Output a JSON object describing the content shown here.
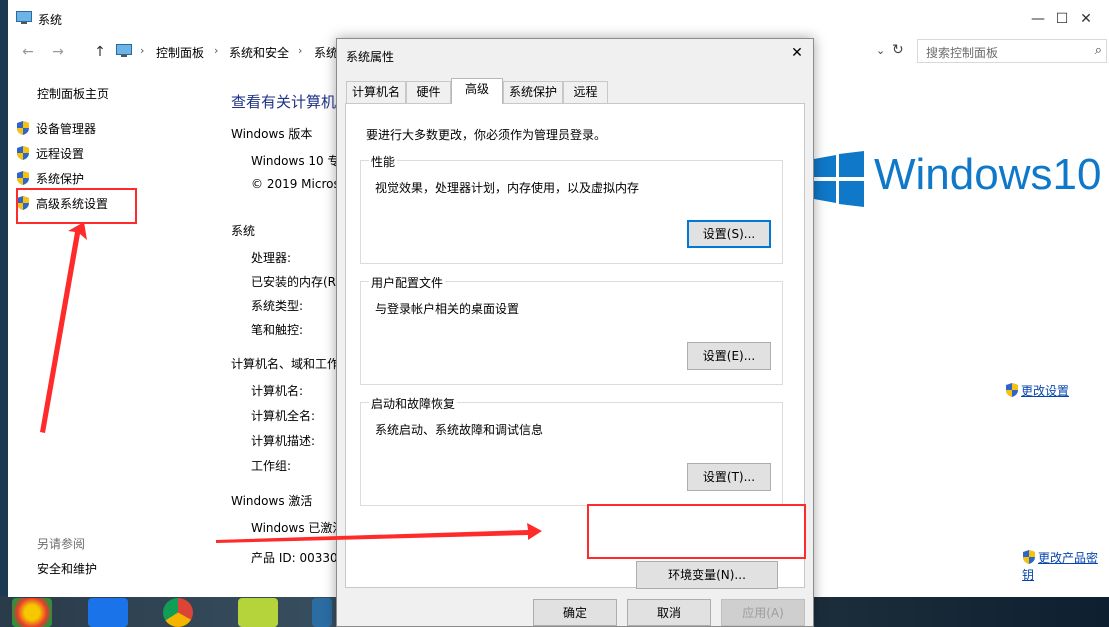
{
  "window": {
    "title": "系统",
    "minimize": "—",
    "maximize": "☐",
    "close": "✕"
  },
  "address": {
    "back": "←",
    "forward": "→",
    "up": "↑",
    "crumbs": [
      "控制面板",
      "系统和安全",
      "系统"
    ],
    "search_placeholder": "搜索控制面板"
  },
  "left_pane": {
    "home": "控制面板主页",
    "items": [
      "设备管理器",
      "远程设置",
      "系统保护",
      "高级系统设置"
    ],
    "see_also": "另请参阅",
    "security": "安全和维护"
  },
  "main": {
    "title": "查看有关计算机",
    "windows_edition_head": "Windows 版本",
    "edition": "Windows 10 专",
    "copyright": "© 2019 Micros",
    "system_head": "系统",
    "processor": "处理器:",
    "ram": "已安装的内存(R",
    "system_type": "系统类型:",
    "pen_touch": "笔和触控:",
    "computer_name_head": "计算机名、域和工作",
    "computer_name": "计算机名:",
    "full_name": "计算机全名:",
    "description": "计算机描述:",
    "workgroup": "工作组:",
    "activation_head": "Windows 激活",
    "activation": "Windows 已激活",
    "product_id": "产品 ID: 00330",
    "logo_text": "Windows10",
    "change_settings": "更改设置",
    "change_key": "更改产品密钥"
  },
  "dialog": {
    "title": "系统属性",
    "close": "✕",
    "tabs": [
      "计算机名",
      "硬件",
      "高级",
      "系统保护",
      "远程"
    ],
    "admin_note": "要进行大多数更改，你必须作为管理员登录。",
    "performance": {
      "label": "性能",
      "desc": "视觉效果，处理器计划，内存使用，以及虚拟内存",
      "button": "设置(S)..."
    },
    "profiles": {
      "label": "用户配置文件",
      "desc": "与登录帐户相关的桌面设置",
      "button": "设置(E)..."
    },
    "startup": {
      "label": "启动和故障恢复",
      "desc": "系统启动、系统故障和调试信息",
      "button": "设置(T)..."
    },
    "env_button": "环境变量(N)...",
    "ok": "确定",
    "cancel": "取消",
    "apply": "应用(A)"
  },
  "colors": {
    "accent": "#0078d7",
    "annotation": "#ff2b2b",
    "link": "#0645ad"
  }
}
